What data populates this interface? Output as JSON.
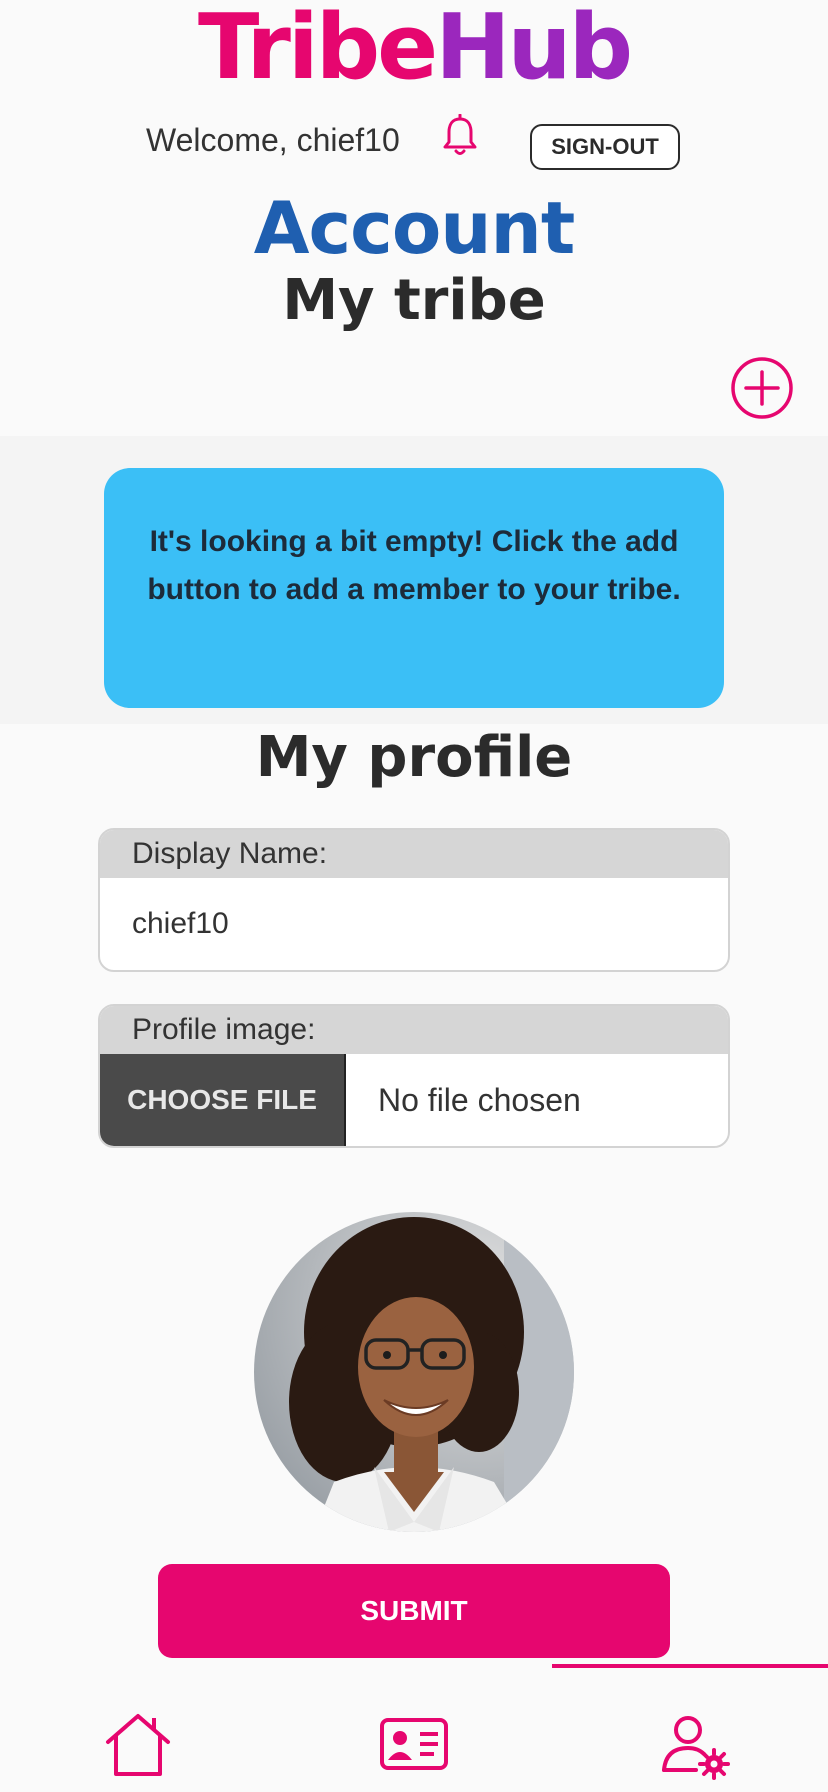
{
  "app": {
    "logo_part1": "Tribe",
    "logo_part2": "Hub",
    "brand_color": "#e6066f",
    "accent_purple": "#9b27bd",
    "accent_blue": "#1f5fb0"
  },
  "header": {
    "welcome_text": "Welcome, chief10",
    "notification_icon": "bell-icon",
    "sign_out_label": "SIGN-OUT"
  },
  "page": {
    "title": "Account",
    "tribe_section_title": "My tribe",
    "add_icon": "plus-circle-icon",
    "empty_message": "It's looking a bit empty! Click the add button to add a member to your tribe.",
    "profile_section_title": "My profile"
  },
  "profile_form": {
    "display_name_label": "Display Name:",
    "display_name_value": "chief10",
    "profile_image_label": "Profile image:",
    "choose_file_label": "CHOOSE FILE",
    "file_status": "No file chosen",
    "submit_label": "SUBMIT"
  },
  "bottom_nav": {
    "items": [
      {
        "icon": "home-icon",
        "active": false
      },
      {
        "icon": "id-card-icon",
        "active": false
      },
      {
        "icon": "user-settings-icon",
        "active": true
      }
    ]
  }
}
